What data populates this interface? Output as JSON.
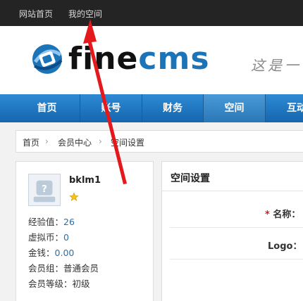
{
  "topbar": {
    "home_link": "网站首页",
    "space_link": "我的空间"
  },
  "header": {
    "logo_fine": "fine",
    "logo_cms": "cms",
    "slogan": "这是一"
  },
  "nav": {
    "items": [
      "首页",
      "账号",
      "财务",
      "空间",
      "互动"
    ],
    "active": "空间"
  },
  "breadcrumb": {
    "home": "首页",
    "member_center": "会员中心",
    "current": "空间设置"
  },
  "user": {
    "username": "bklm1",
    "exp_label": "经验值：",
    "exp_value": "26",
    "coin_label": "虚拟币：",
    "coin_value": "0",
    "money_label": "金钱：",
    "money_value": "0.00",
    "group_label": "会员组：",
    "group_value": "普通会员",
    "level_label": "会员等级：",
    "level_value": "初级"
  },
  "settings": {
    "title": "空间设置",
    "name_required": "*",
    "name_label": "名称：",
    "logo_label": "Logo："
  },
  "colors": {
    "nav_blue": "#1b73b8",
    "topbar": "#242424",
    "link_blue": "#2a6db0",
    "required_red": "#d41a1a"
  },
  "icons": {
    "avatar": "avatar-placeholder-icon",
    "star": "star-icon",
    "breadcrumb_sep": "chevron-right-icon",
    "annotation": "red-arrow"
  }
}
